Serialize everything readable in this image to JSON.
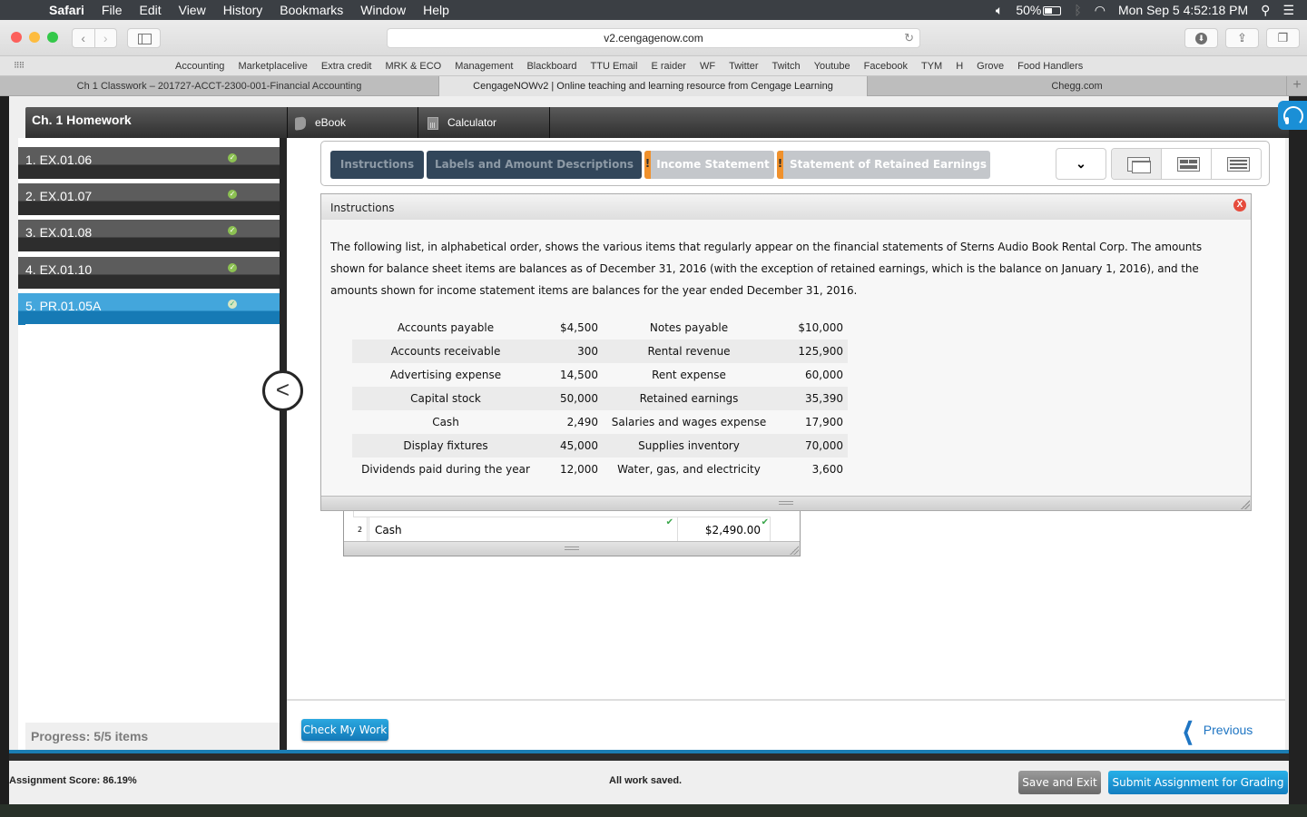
{
  "menubar": {
    "app_name": "Safari",
    "items": [
      "File",
      "Edit",
      "View",
      "History",
      "Bookmarks",
      "Window",
      "Help"
    ],
    "battery": "50%",
    "datetime": "Mon Sep 5  4:52:18 PM"
  },
  "browser": {
    "url": "v2.cengagenow.com",
    "bookmarks": [
      "Accounting",
      "Marketplacelive",
      "Extra credit",
      "MRK & ECO",
      "Management",
      "Blackboard",
      "TTU Email",
      "E raider",
      "WF",
      "Twitter",
      "Twitch",
      "Youtube",
      "Facebook",
      "TYM",
      "H",
      "Grove",
      "Food Handlers"
    ],
    "tabs": [
      {
        "title": "Ch 1 Classwork – 201727-ACCT-2300-001-Financial Accounting",
        "active": false
      },
      {
        "title": "CengageNOWv2 | Online teaching and learning resource from Cengage Learning",
        "active": true
      },
      {
        "title": "Chegg.com",
        "active": false
      }
    ]
  },
  "app": {
    "assignment_title": "Ch. 1 Homework",
    "tools": {
      "ebook": "eBook",
      "calculator": "Calculator"
    },
    "sidebar": {
      "items": [
        {
          "label": "1. EX.01.06",
          "status": "complete"
        },
        {
          "label": "2. EX.01.07",
          "status": "complete"
        },
        {
          "label": "3. EX.01.08",
          "status": "complete"
        },
        {
          "label": "4. EX.01.10",
          "status": "complete"
        },
        {
          "label": "5. PR.01.05A",
          "status": "active"
        }
      ],
      "progress": "Progress:  5/5 items"
    },
    "question_tabs": [
      {
        "label": "Instructions",
        "warning": false
      },
      {
        "label": "Labels and Amount Descriptions",
        "warning": false
      },
      {
        "label": "Income Statement",
        "warning": true
      },
      {
        "label": "Statement of Retained Earnings",
        "warning": true
      }
    ],
    "warning_glyph": "!",
    "instructions": {
      "title": "Instructions",
      "close_label": "X",
      "text": "The following list, in alphabetical order, shows the various items that regularly appear on the financial statements of Sterns Audio Book Rental Corp. The amounts shown for balance sheet items are balances as of December 31, 2016 (with the exception of retained earnings, which is the balance on January 1, 2016), and the amounts shown for income statement items are balances for the year ended December 31, 2016.",
      "rows": [
        {
          "item1": "Accounts payable",
          "amount1": "$4,500",
          "item2": "Notes payable",
          "amount2": "$10,000"
        },
        {
          "item1": "Accounts receivable",
          "amount1": "300",
          "item2": "Rental revenue",
          "amount2": "125,900"
        },
        {
          "item1": "Advertising expense",
          "amount1": "14,500",
          "item2": "Rent expense",
          "amount2": "60,000"
        },
        {
          "item1": "Capital stock",
          "amount1": "50,000",
          "item2": "Retained earnings",
          "amount2": "35,390"
        },
        {
          "item1": "Cash",
          "amount1": "2,490",
          "item2": "Salaries and wages expense",
          "amount2": "17,900"
        },
        {
          "item1": "Display fixtures",
          "amount1": "45,000",
          "item2": "Supplies inventory",
          "amount2": "70,000"
        },
        {
          "item1": "Dividends paid during the year",
          "amount1": "12,000",
          "item2": "Water, gas, and electricity",
          "amount2": "3,600"
        }
      ]
    },
    "worksheet": {
      "row_number": "2",
      "account": "Cash",
      "amount": "$2,490.00",
      "check_glyph": "✔"
    },
    "buttons": {
      "check_my_work": "Check My Work",
      "previous": "Previous",
      "save_and_exit": "Save and Exit",
      "submit": "Submit Assignment for Grading"
    },
    "footer": {
      "score": "Assignment Score: 86.19%",
      "status": "All work saved."
    }
  }
}
